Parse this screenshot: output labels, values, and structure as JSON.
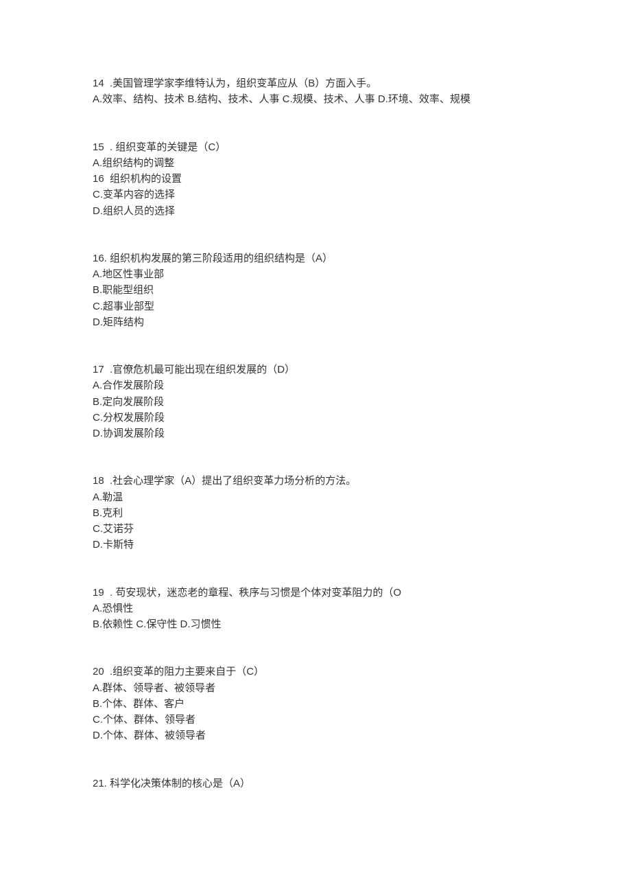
{
  "questions": [
    {
      "lines": [
        "14  .美国管理学家李维特认为，组织变革应从（B）方面入手。",
        "A.效率、结构、技术 B.结构、技术、人事 C.规模、技术、人事 D.环境、效率、规模"
      ]
    },
    {
      "lines": [
        "15  . 组织变革的关键是（C）",
        "A.组织结构的调整",
        "16  组织机构的设置",
        "C.变革内容的选择",
        "D.组织人员的选择"
      ]
    },
    {
      "lines": [
        "16. 组织机构发展的第三阶段适用的组织结构是（A）",
        "A.地区性事业部",
        "B.职能型组织",
        "C.超事业部型",
        "D.矩阵结构"
      ]
    },
    {
      "lines": [
        "17  .官僚危机最可能出现在组织发展的（D）",
        "A.合作发展阶段",
        "B.定向发展阶段",
        "C.分权发展阶段",
        "D.协调发展阶段"
      ]
    },
    {
      "lines": [
        "18  .社会心理学家（A）提出了组织变革力场分析的方法。",
        "A.勒温",
        "B.克利",
        "C.艾诺芬",
        "D.卡斯特"
      ]
    },
    {
      "lines": [
        "19  . 苟安现状，迷恋老的章程、秩序与习惯是个体对变革阻力的（O",
        "A.恐惧性",
        "B.依赖性 C.保守性 D.习惯性"
      ]
    },
    {
      "lines": [
        "20  .组织变革的阻力主要来自于（C）",
        "A.群体、领导者、被领导者",
        "B.个体、群体、客户",
        "C.个体、群体、领导者",
        "D.个体、群体、被领导者"
      ]
    },
    {
      "lines": [
        "21. 科学化决策体制的核心是（A）"
      ]
    }
  ]
}
